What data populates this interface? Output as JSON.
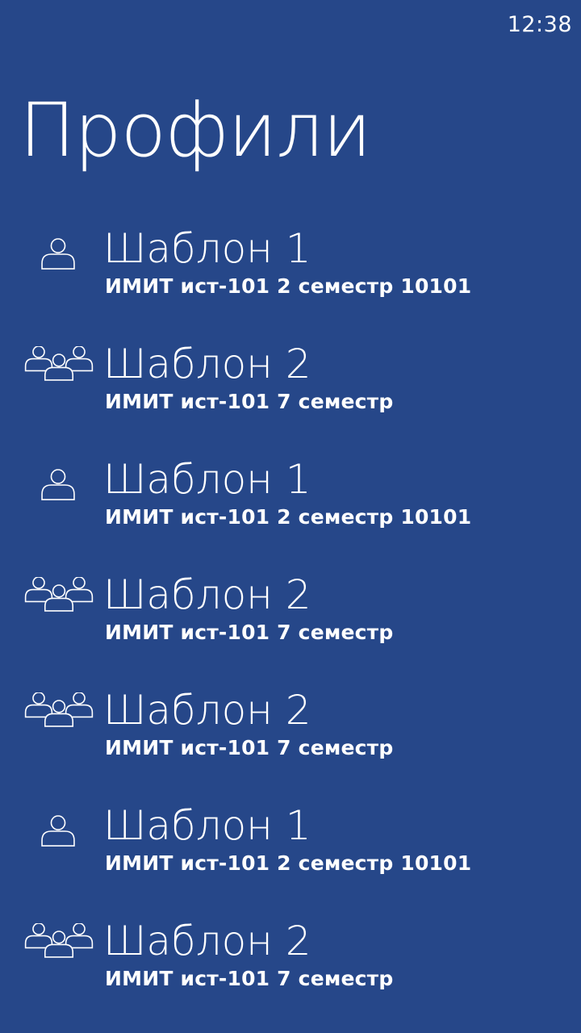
{
  "status_bar": {
    "time": "12:38"
  },
  "page": {
    "title": "Профили"
  },
  "profiles": [
    {
      "title": "Шаблон 1",
      "subtitle": "ИМИТ ист-101 2 семестр 10101",
      "icon": "person-icon"
    },
    {
      "title": "Шаблон 2",
      "subtitle": "ИМИТ ист-101 7 семестр",
      "icon": "group-icon"
    },
    {
      "title": "Шаблон 1",
      "subtitle": "ИМИТ ист-101 2 семестр 10101",
      "icon": "person-icon"
    },
    {
      "title": "Шаблон 2",
      "subtitle": "ИМИТ ист-101 7 семестр",
      "icon": "group-icon"
    },
    {
      "title": "Шаблон 2",
      "subtitle": "ИМИТ ист-101 7 семестр",
      "icon": "group-icon"
    },
    {
      "title": "Шаблон 1",
      "subtitle": "ИМИТ ист-101 2 семестр 10101",
      "icon": "person-icon"
    },
    {
      "title": "Шаблон 2",
      "subtitle": "ИМИТ ист-101 7 семестр",
      "icon": "group-icon"
    }
  ],
  "colors": {
    "background": "#264789",
    "foreground": "#ffffff"
  }
}
